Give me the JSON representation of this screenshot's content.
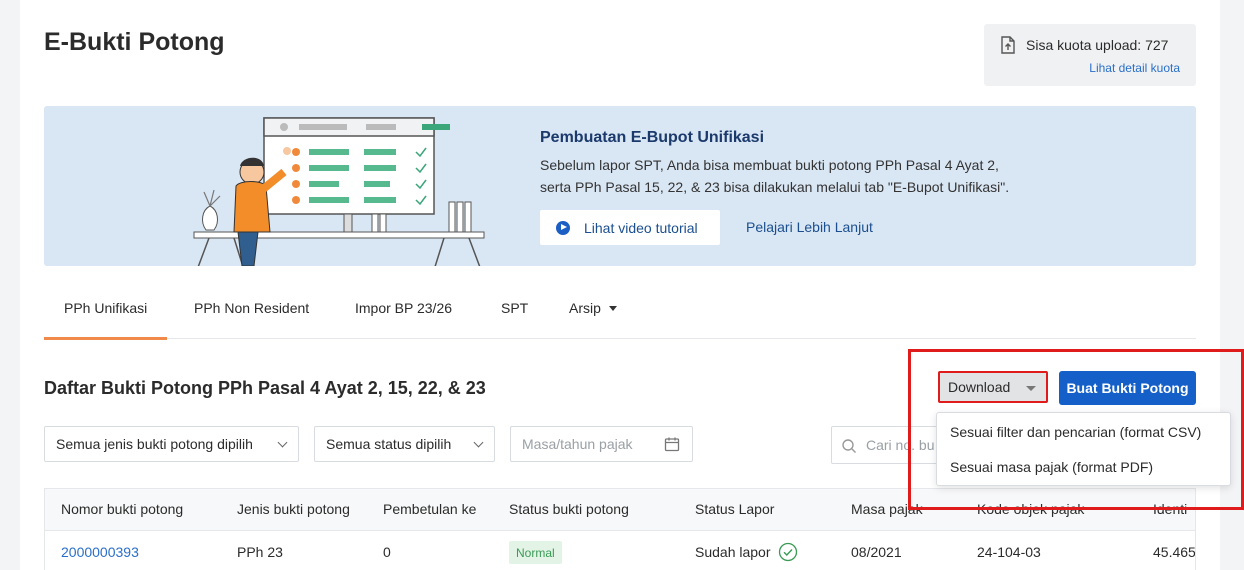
{
  "page": {
    "title": "E-Bukti Potong"
  },
  "quota": {
    "label": "Sisa kuota upload: 727",
    "link": "Lihat detail kuota"
  },
  "banner": {
    "title": "Pembuatan E-Bupot Unifikasi",
    "description_line1": "Sebelum lapor SPT, Anda bisa membuat bukti potong PPh Pasal 4 Ayat 2,",
    "description_line2": "serta PPh Pasal 15, 22, & 23 bisa dilakukan melalui tab \"E-Bupot Unifikasi\".",
    "video_button": "Lihat video tutorial",
    "learn_link": "Pelajari Lebih Lanjut"
  },
  "tabs": [
    {
      "label": "PPh Unifikasi",
      "active": true
    },
    {
      "label": "PPh Non Resident"
    },
    {
      "label": "Impor BP 23/26"
    },
    {
      "label": "SPT"
    },
    {
      "label": "Arsip"
    }
  ],
  "section": {
    "title": "Daftar Bukti Potong PPh Pasal 4 Ayat 2, 15, 22, & 23"
  },
  "actions": {
    "download": "Download",
    "create": "Buat Bukti Potong",
    "download_menu": [
      "Sesuai filter dan pencarian (format CSV)",
      "Sesuai masa pajak (format PDF)"
    ]
  },
  "filters": {
    "type": "Semua jenis bukti potong dipilih",
    "status": "Semua status dipilih",
    "period_placeholder": "Masa/tahun pajak",
    "search_placeholder": "Cari no. bu"
  },
  "table": {
    "headers": [
      "Nomor bukti potong",
      "Jenis bukti potong",
      "Pembetulan ke",
      "Status bukti potong",
      "Status Lapor",
      "Masa pajak",
      "Kode objek pajak",
      "Identi"
    ],
    "rows": [
      {
        "nomor": "2000000393",
        "jenis": "PPh 23",
        "pembetulan": "0",
        "status": "Normal",
        "lapor": "Sudah lapor",
        "masa": "08/2021",
        "kode": "24-104-03",
        "identitas": "45.465"
      }
    ]
  },
  "colors": {
    "primary": "#1460c8",
    "accent_tab": "#f08a4b",
    "highlight": "#e01b1b",
    "banner_bg": "#d9e6f4",
    "success": "#3a9a55"
  }
}
